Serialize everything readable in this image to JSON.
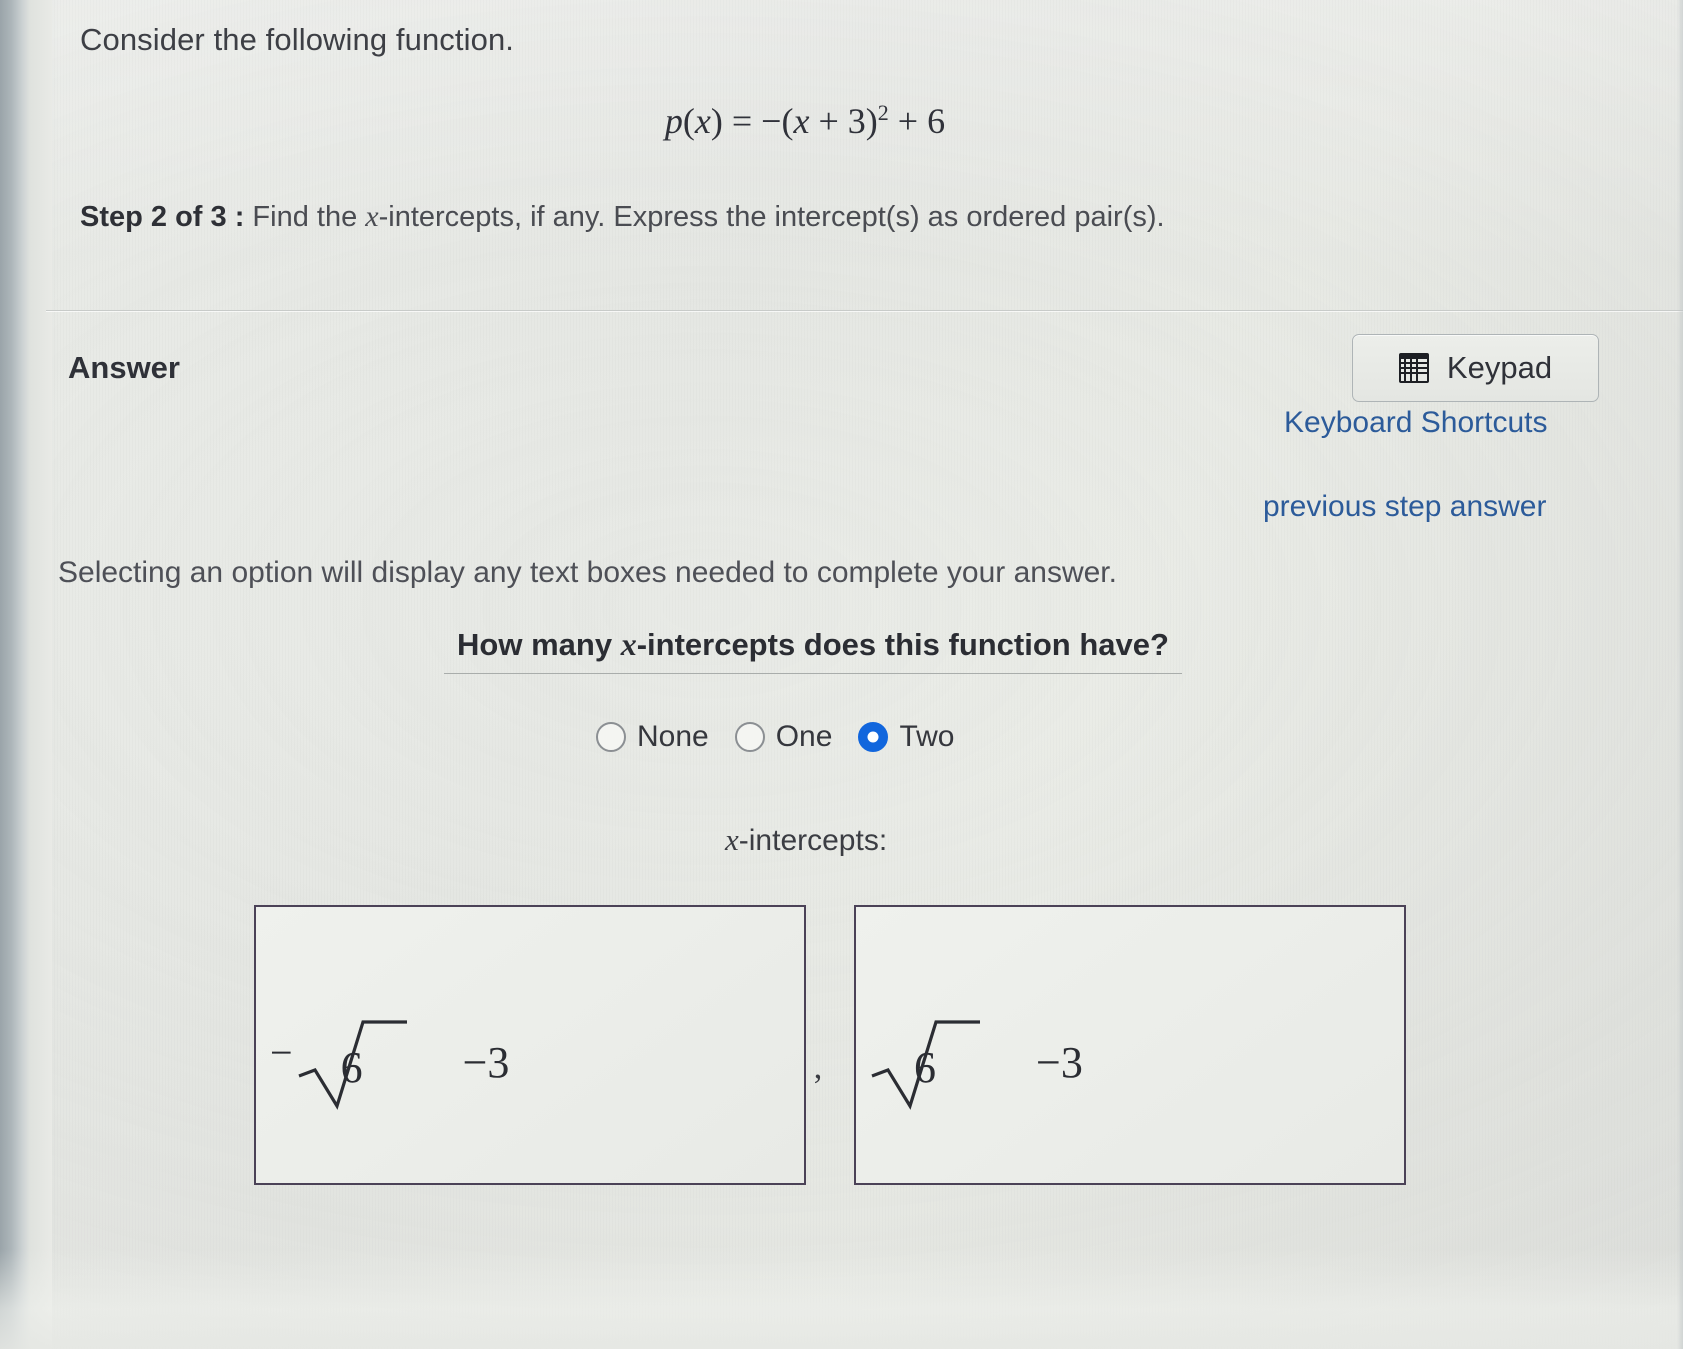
{
  "stem": {
    "intro": "Consider the following function.",
    "function_text": "p(x) = −(x + 3)² + 6",
    "function_lhs": "p",
    "function_var": "x",
    "step_label": "Step 2 of 3 :",
    "step_instruction_pre": "Find the ",
    "step_instruction_var": "x",
    "step_instruction_post": "-intercepts, if any. Express the intercept(s) as ordered pair(s)."
  },
  "answer_section": {
    "heading": "Answer",
    "keypad_button_label": "Keypad",
    "keypad_icon": "keypad-grid-icon",
    "keyboard_shortcuts_link": "Keyboard Shortcuts",
    "previous_step_answer_link": "previous step answer",
    "selection_note": "Selecting an option will display any text boxes needed to complete your answer.",
    "question_pre": "How many ",
    "question_var": "x",
    "question_post": "-intercepts does this function have?",
    "options": [
      {
        "label": "None",
        "selected": false
      },
      {
        "label": "One",
        "selected": false
      },
      {
        "label": "Two",
        "selected": true
      }
    ],
    "selected_option": "Two",
    "intercepts_label_var": "x",
    "intercepts_label_post": "-intercepts:",
    "separator": ",",
    "intercept_boxes": [
      {
        "value": "−√6 −3",
        "leading_sign": "−",
        "radicand": "6",
        "tail": "−3"
      },
      {
        "value": "√6 −3",
        "leading_sign": "",
        "radicand": "6",
        "tail": "−3"
      }
    ]
  },
  "colors": {
    "link": "#2c5b9a",
    "radio_selected": "#1166dd",
    "box_border": "#4b4257",
    "text": "#2f3138",
    "page_bg": "#e9eae5"
  }
}
